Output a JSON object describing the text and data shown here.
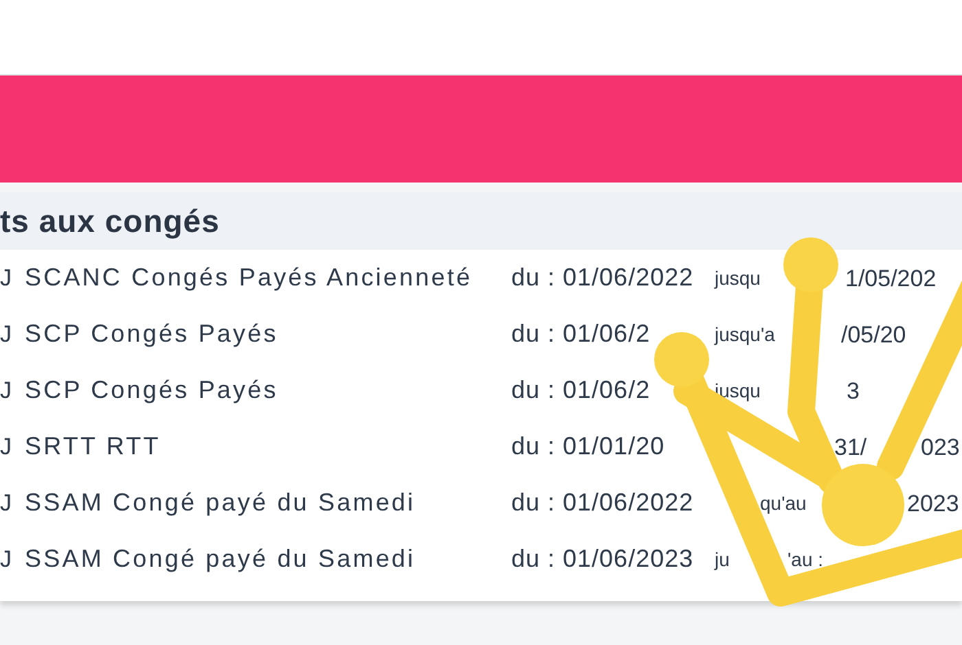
{
  "section": {
    "title": "ts aux congés"
  },
  "rows": [
    {
      "marker": "J",
      "label": "SCANC Congés Payés Ancienneté",
      "from": "du : 01/06/2022",
      "until_parts": [
        {
          "kind": "word",
          "text": "jusqu"
        },
        {
          "kind": "date",
          "text": "1/05/202"
        }
      ]
    },
    {
      "marker": "J",
      "label": "SCP Congés Payés",
      "from": "du : 01/06/2",
      "until_parts": [
        {
          "kind": "word",
          "text": "jusqu'a"
        },
        {
          "kind": "date",
          "text": "/05/20"
        }
      ]
    },
    {
      "marker": "J",
      "label": "SCP Congés Payés",
      "from": "du : 01/06/2",
      "until_parts": [
        {
          "kind": "word",
          "text": "jusqu"
        },
        {
          "kind": "date",
          "text": "3"
        }
      ]
    },
    {
      "marker": "J",
      "label": "SRTT RTT",
      "from": "du : 01/01/20",
      "until_parts": [
        {
          "kind": "date",
          "text": "31/"
        },
        {
          "kind": "date",
          "text": "023"
        }
      ]
    },
    {
      "marker": "J",
      "label": "SSAM Congé payé du Samedi",
      "from": "du : 01/06/2022",
      "until_parts": [
        {
          "kind": "word",
          "text": "qu'au"
        },
        {
          "kind": "date",
          "text": "2023"
        }
      ]
    },
    {
      "marker": "J",
      "label": "SSAM Congé payé du Samedi",
      "from": "du : 01/06/2023",
      "until_parts": [
        {
          "kind": "word",
          "text": "ju"
        },
        {
          "kind": "word",
          "text": "'au :"
        }
      ]
    }
  ]
}
